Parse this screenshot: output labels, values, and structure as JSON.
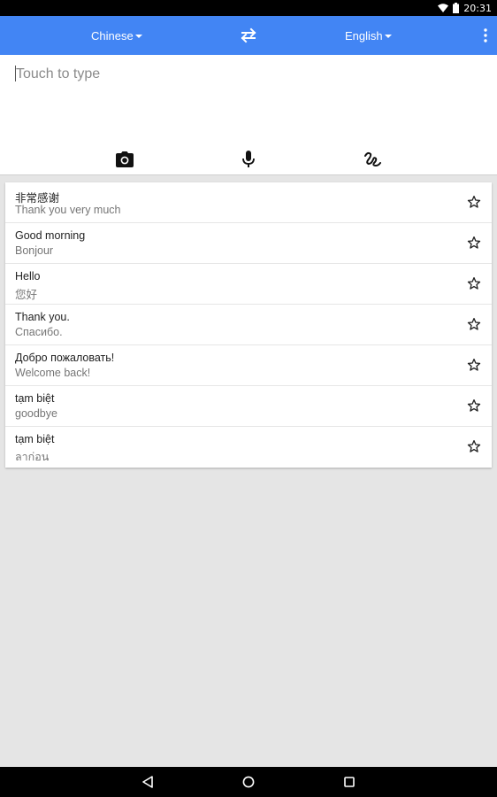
{
  "status_bar": {
    "time": "20:31",
    "icons": [
      "wifi-icon",
      "battery-icon"
    ]
  },
  "app_bar": {
    "source_language": "Chinese",
    "target_language": "English",
    "swap_icon": "swap-arrows-icon",
    "menu_icon": "more-vert-icon"
  },
  "input": {
    "placeholder": "Touch to type",
    "value": ""
  },
  "tools": [
    "camera-icon",
    "microphone-icon",
    "handwriting-icon"
  ],
  "history": [
    {
      "source": "非常感谢",
      "translation": "Thank you very much",
      "starred": false
    },
    {
      "source": "Good morning",
      "translation": "Bonjour",
      "starred": false
    },
    {
      "source": "Hello",
      "translation": "您好",
      "starred": false
    },
    {
      "source": "Thank you.",
      "translation": "Спасибо.",
      "starred": false
    },
    {
      "source": "Добро пожаловать!",
      "translation": "Welcome back!",
      "starred": false
    },
    {
      "source": "tạm biệt",
      "translation": "goodbye",
      "starred": false
    },
    {
      "source": "tạm biệt",
      "translation": "ลาก่อน",
      "starred": false
    }
  ],
  "nav_bar": [
    "back-icon",
    "home-icon",
    "recents-icon"
  ]
}
